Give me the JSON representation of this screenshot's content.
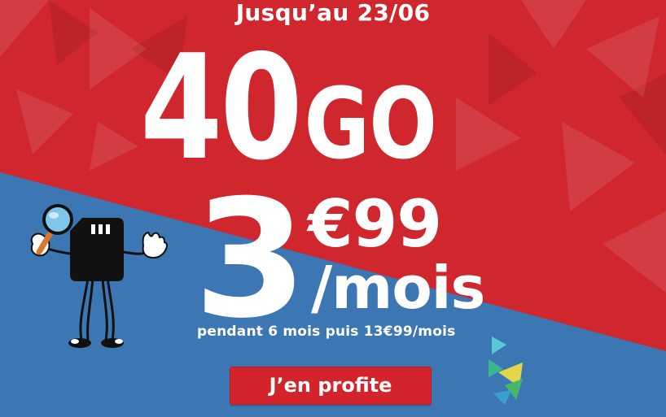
{
  "promo": {
    "until": "Jusqu’au 23/06",
    "data_amount": "40",
    "data_unit": "GO",
    "price_integer": "3",
    "price_decimals": "€99",
    "per_month": "/mois",
    "condition": "pendant 6 mois puis 13€99/mois",
    "cta_label": "J’en profite"
  },
  "colors": {
    "red_background": "#d0262e",
    "blue_background": "#3d77b3",
    "cta_background": "#d3242b",
    "text": "#ffffff"
  },
  "icons": {
    "mascot": "sim-card-mascot-with-magnifier-icon",
    "logo": "triangle-brand-logo-icon"
  }
}
